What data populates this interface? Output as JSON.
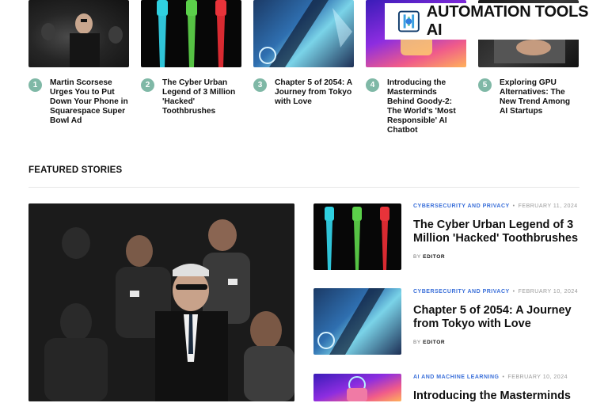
{
  "brand": {
    "name": "AUTOMATION TOOLS AI",
    "logo": "brand-logo-icon"
  },
  "trending": [
    {
      "num": "1",
      "title": "Martin Scorsese Urges You to Put Down Your Phone in Squarespace Super Bowl Ad"
    },
    {
      "num": "2",
      "title": "The Cyber Urban Legend of 3 Million 'Hacked' Toothbrushes"
    },
    {
      "num": "3",
      "title": "Chapter 5 of 2054: A Journey from Tokyo with Love"
    },
    {
      "num": "4",
      "title": "Introducing the Masterminds Behind Goody-2: The World's 'Most Responsible' AI Chatbot"
    },
    {
      "num": "5",
      "title": "Exploring GPU Alternatives: The New Trend Among AI Startups"
    }
  ],
  "featured": {
    "heading": "FEATURED STORIES",
    "stories": [
      {
        "category": "CYBERSECURITY AND PRIVACY",
        "date": "FEBRUARY 11, 2024",
        "title": "The Cyber Urban Legend of 3 Million 'Hacked' Toothbrushes",
        "by": "BY",
        "author": "EDITOR"
      },
      {
        "category": "CYBERSECURITY AND PRIVACY",
        "date": "FEBRUARY 10, 2024",
        "title": "Chapter 5 of 2054: A Journey from Tokyo with Love",
        "by": "BY",
        "author": "EDITOR"
      },
      {
        "category": "AI AND MACHINE LEARNING",
        "date": "FEBRUARY 10, 2024",
        "title": "Introducing the Masterminds"
      }
    ]
  },
  "colors": {
    "accent": "#3a6fd9",
    "number_badge": "#7fb8a6"
  }
}
